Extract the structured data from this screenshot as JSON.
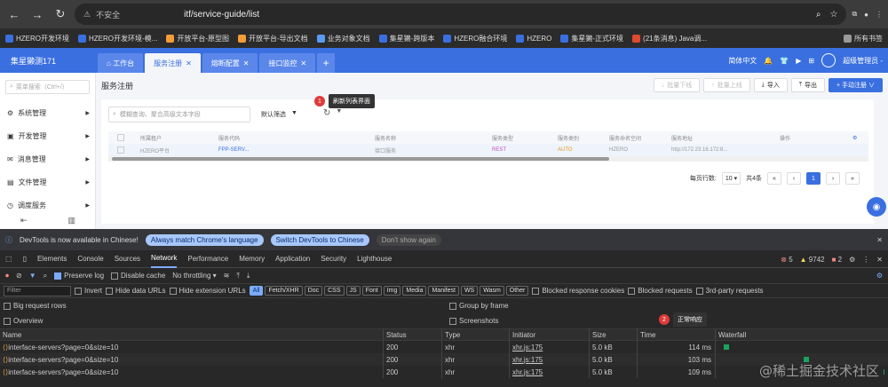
{
  "browser": {
    "security": "不安全",
    "url_path": "itf/service-guide/list"
  },
  "bookmarks": [
    {
      "label": "HZERO开发环境",
      "color": "#3a6fe0"
    },
    {
      "label": "HZERO开发环境-模...",
      "color": "#3a6fe0"
    },
    {
      "label": "开放平台-原型图",
      "color": "#f29d38"
    },
    {
      "label": "开放平台-导出文档",
      "color": "#f29d38"
    },
    {
      "label": "业务对象文档",
      "color": "#5a9bf0"
    },
    {
      "label": "集星獭-跨版本",
      "color": "#3a6fe0"
    },
    {
      "label": "HZERO融合环境",
      "color": "#3a6fe0"
    },
    {
      "label": "HZERO",
      "color": "#3a6fe0"
    },
    {
      "label": "集星獭-正式环境",
      "color": "#3a6fe0"
    },
    {
      "label": "(21条消息) Java调...",
      "color": "#e04a2f"
    },
    {
      "label": "所有书签",
      "color": "#999"
    }
  ],
  "app": {
    "tenant": "集星獭测171",
    "tabs": [
      {
        "label": "工作台"
      },
      {
        "label": "服务注册"
      },
      {
        "label": "熔断配置"
      },
      {
        "label": "接口监控"
      }
    ],
    "topright": {
      "lang": "简体中文",
      "user": "超级管理员 -"
    },
    "menu_search": "菜单搜索（Ctrl+/）",
    "menu": [
      "系统管理",
      "开发管理",
      "消息管理",
      "文件管理",
      "调度服务"
    ],
    "page_title": "服务注册",
    "buttons": {
      "b1": "批量下线",
      "b2": "批量上线",
      "import": "导入",
      "export": "导出",
      "register": "+ 手动注册 ∨"
    },
    "filter_placeholder": "模糊查询、聚合高级文本字段",
    "filter_select": "默认筛选",
    "callout1": {
      "num": "1",
      "text": "刷新列表界面"
    },
    "columns": [
      "所属租户",
      "服务代码",
      "服务名称",
      "服务类型",
      "服务类别",
      "服务命名空间",
      "服务地址",
      "操作"
    ],
    "row": [
      "HZERO平台",
      "FPP-SERV...",
      "接口服务",
      "REST",
      "AUTO",
      "HZERO",
      "http://172.23.16.172:8...",
      ""
    ],
    "pager": {
      "label": "每页行数:",
      "size": "10",
      "total": "共4条",
      "page": "1"
    }
  },
  "devtools": {
    "banner": "DevTools is now available in Chinese!",
    "btn1": "Always match Chrome's language",
    "btn2": "Switch DevTools to Chinese",
    "btn3": "Don't show again",
    "tabs": [
      "Elements",
      "Console",
      "Sources",
      "Network",
      "Performance",
      "Memory",
      "Application",
      "Security",
      "Lighthouse"
    ],
    "counts": {
      "errors": "5",
      "warnings": "9742",
      "issues": "2"
    },
    "preserve": "Preserve log",
    "disable_cache": "Disable cache",
    "throttle": "No throttling",
    "filter_placeholder": "Filter",
    "invert": "Invert",
    "hide_data": "Hide data URLs",
    "hide_ext": "Hide extension URLs",
    "chips": [
      "All",
      "Fetch/XHR",
      "Doc",
      "CSS",
      "JS",
      "Font",
      "Img",
      "Media",
      "Manifest",
      "WS",
      "Wasm",
      "Other"
    ],
    "blocked_cookies": "Blocked response cookies",
    "blocked_req": "Blocked requests",
    "third_party": "3rd-party requests",
    "big_rows": "Big request rows",
    "group_frame": "Group by frame",
    "overview": "Overview",
    "screenshots": "Screenshots",
    "callout2": {
      "num": "2",
      "text": "正常响应"
    },
    "headers": [
      "Name",
      "Status",
      "Type",
      "Initiator",
      "Size",
      "Time",
      "Waterfall"
    ],
    "rows": [
      {
        "name": "interface-servers?page=0&size=10",
        "status": "200",
        "type": "xhr",
        "initiator": "xhr.js:175",
        "size": "5.0 kB",
        "time": "114 ms"
      },
      {
        "name": "interface-servers?page=0&size=10",
        "status": "200",
        "type": "xhr",
        "initiator": "xhr.js:175",
        "size": "5.0 kB",
        "time": "103 ms"
      },
      {
        "name": "interface-servers?page=0&size=10",
        "status": "200",
        "type": "xhr",
        "initiator": "xhr.js:175",
        "size": "5.0 kB",
        "time": "109 ms"
      }
    ],
    "watermark": "@稀土掘金技术社区"
  }
}
